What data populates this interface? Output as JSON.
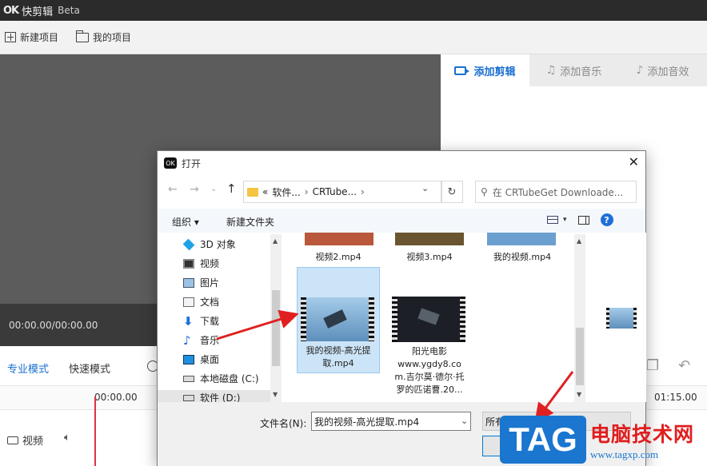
{
  "app": {
    "logo_text": "OK",
    "name": "快剪辑",
    "edition": "Beta"
  },
  "menubar": {
    "new_project": "新建项目",
    "my_projects": "我的项目"
  },
  "preview": {
    "timecode": "00:00.00/00:00.00"
  },
  "right_tabs": [
    {
      "label": "添加剪辑",
      "icon": "camera-icon",
      "active": true
    },
    {
      "label": "添加音乐",
      "icon": "music-icon",
      "active": false
    },
    {
      "label": "添加音效",
      "icon": "sound-effect-icon",
      "active": false
    }
  ],
  "timeline": {
    "mode_pro": "专业模式",
    "mode_quick": "快速模式",
    "time_start": "00:00.00",
    "time_end": "01:15.00",
    "track_label": "视频"
  },
  "dialog": {
    "title": "打开",
    "address": {
      "prefix": "«",
      "part1": "软件...",
      "part2": "CRTube..."
    },
    "search_placeholder": "在 CRTubeGet Downloade...",
    "toolbar": {
      "organize": "组织 ▾",
      "new_folder": "新建文件夹"
    },
    "nav_items": [
      {
        "label": "3D 对象",
        "icon": "3d-objects-icon"
      },
      {
        "label": "视频",
        "icon": "videos-icon"
      },
      {
        "label": "图片",
        "icon": "pictures-icon"
      },
      {
        "label": "文档",
        "icon": "documents-icon"
      },
      {
        "label": "下载",
        "icon": "downloads-icon"
      },
      {
        "label": "音乐",
        "icon": "music-icon"
      },
      {
        "label": "桌面",
        "icon": "desktop-icon"
      },
      {
        "label": "本地磁盘 (C:)",
        "icon": "drive-icon"
      },
      {
        "label": "软件 (D:)",
        "icon": "drive-icon"
      }
    ],
    "files": [
      {
        "label": "视频2.mp4"
      },
      {
        "label": "视频3.mp4"
      },
      {
        "label": "我的视频.mp4"
      },
      {
        "label": "我的视频-高光提\n取.mp4",
        "selected": true
      },
      {
        "label": "阳光电影\nwww.ygdy8.co\nm.吉尔莫·德尔·托\n罗的匹诺曹.20..."
      }
    ],
    "filename_label": "文件名(N):",
    "filename_value": "我的视频-高光提取.mp4",
    "filetype_value": "所有"
  },
  "watermark": {
    "tag": "TAG",
    "site_name": "电脑技术网",
    "url": "www.tagxp.com"
  },
  "colors": {
    "accent": "#1a6fd1",
    "arrow": "#e02020",
    "selection": "#cce4f7"
  }
}
